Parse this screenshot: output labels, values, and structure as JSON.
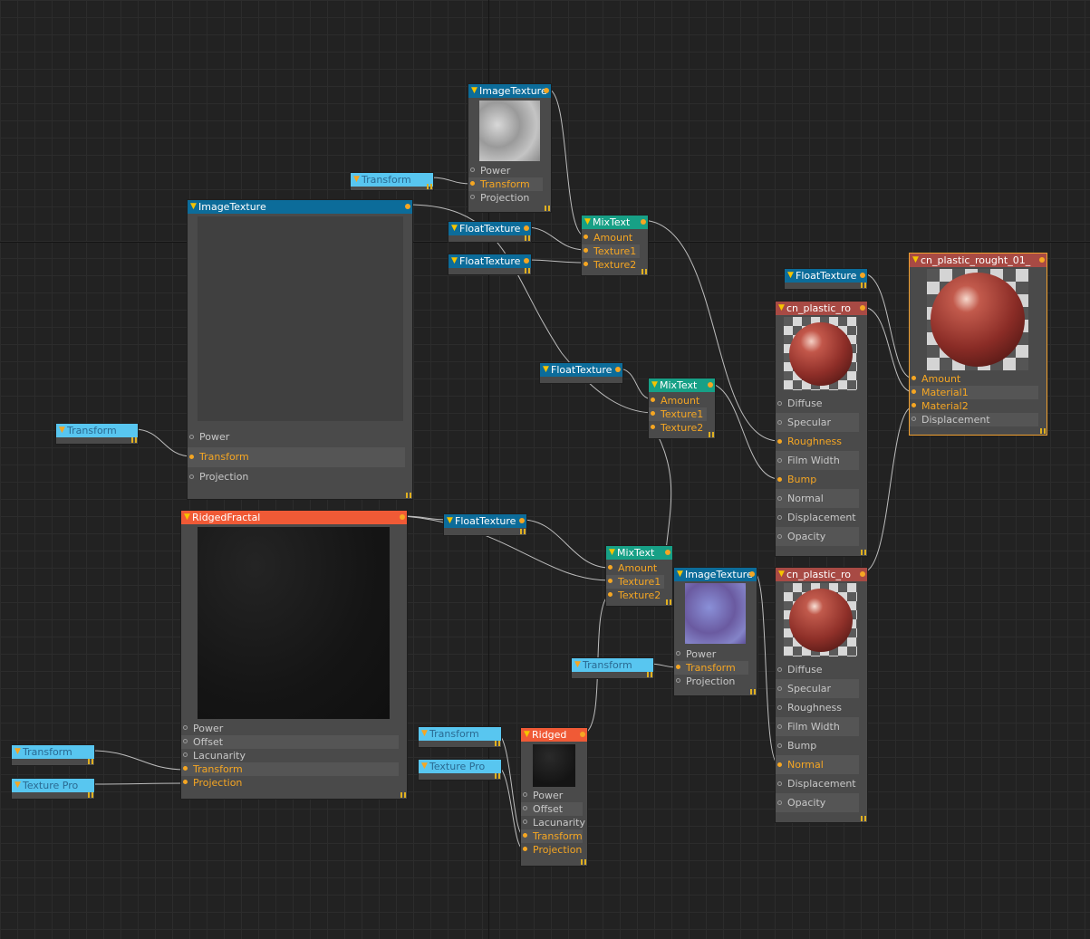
{
  "canvas": {
    "background": "#222222",
    "grid": "#2c2c2c"
  },
  "colors": {
    "header_blue": "#0c6c9a",
    "header_teal": "#17a086",
    "header_orange": "#f05a36",
    "header_red": "#a84a44",
    "header_sky": "#58c6f0",
    "port_active": "#f5a623",
    "selection": "#f0a030",
    "wire": "#bdbdbd"
  },
  "icons": {
    "collapse": "triangle-down-icon",
    "output": "output-dot-icon",
    "resize": "resize-grip-icon"
  },
  "nodes": {
    "imgtex_top": {
      "title": "ImageTexture",
      "ports": [
        "Power",
        "Transform",
        "Projection"
      ]
    },
    "transform_a": {
      "title": "Transform"
    },
    "imgtex_large": {
      "title": "ImageTexture",
      "ports": [
        "Power",
        "Transform",
        "Projection"
      ]
    },
    "floattex_1": {
      "title": "FloatTexture"
    },
    "floattex_2": {
      "title": "FloatTexture"
    },
    "mixtex_1": {
      "title": "MixText",
      "ports": [
        "Amount",
        "Texture1",
        "Texture2"
      ]
    },
    "transform_b": {
      "title": "Transform"
    },
    "floattex_3": {
      "title": "FloatTexture"
    },
    "mixtex_2": {
      "title": "MixText",
      "ports": [
        "Amount",
        "Texture1",
        "Texture2"
      ]
    },
    "floattex_4": {
      "title": "FloatTexture"
    },
    "mat_top": {
      "title": "cn_plastic_ro",
      "ports": [
        "Diffuse",
        "Specular",
        "Roughness",
        "Film Width",
        "Bump",
        "Normal",
        "Displacement",
        "Opacity"
      ]
    },
    "mix_material": {
      "title": "cn_plastic_rought_01_",
      "ports": [
        "Amount",
        "Material1",
        "Material2",
        "Displacement"
      ]
    },
    "ridged_fractal": {
      "title": "RidgedFractal",
      "ports": [
        "Power",
        "Offset",
        "Lacunarity",
        "Transform",
        "Projection"
      ]
    },
    "floattex_5": {
      "title": "FloatTexture"
    },
    "mixtex_3": {
      "title": "MixText",
      "ports": [
        "Amount",
        "Texture1",
        "Texture2"
      ]
    },
    "imgtex_normal": {
      "title": "ImageTexture",
      "ports": [
        "Power",
        "Transform",
        "Projection"
      ]
    },
    "transform_c": {
      "title": "Transform"
    },
    "mat_bottom": {
      "title": "cn_plastic_ro",
      "ports": [
        "Diffuse",
        "Specular",
        "Roughness",
        "Film Width",
        "Bump",
        "Normal",
        "Displacement",
        "Opacity"
      ]
    },
    "transform_d": {
      "title": "Transform"
    },
    "texproj_a": {
      "title": "Texture Pro"
    },
    "transform_e": {
      "title": "Transform"
    },
    "texproj_b": {
      "title": "Texture Pro"
    },
    "ridged": {
      "title": "Ridged",
      "ports": [
        "Power",
        "Offset",
        "Lacunarity",
        "Transform",
        "Projection"
      ]
    }
  }
}
